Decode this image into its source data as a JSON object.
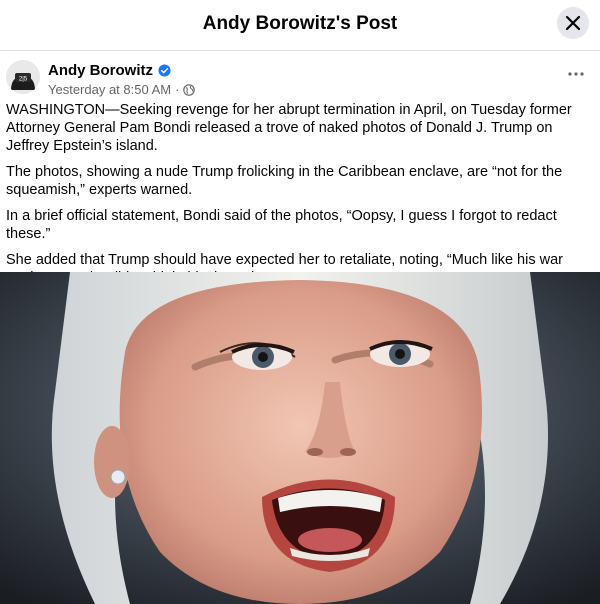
{
  "header": {
    "title": "Andy Borowitz's Post"
  },
  "post": {
    "author": "Andy Borowitz",
    "verified_badge": "verified-icon",
    "timestamp": "Yesterday at 8:50 AM",
    "separator": "·",
    "audience_icon": "globe-icon",
    "paragraphs": [
      "WASHINGTON—Seeking revenge for her abrupt termination in April, on Tuesday former Attorney General Pam Bondi released a trove of naked photos of Donald J. Trump on Jeffrey Epstein’s island.",
      "The photos, showing a nude Trump frolicking in the Caribbean enclave, are “not for the squeamish,” experts warned.",
      "In a brief official statement, Bondi said of the photos, “Oopsy, I guess I forgot to redact these.”",
      "She added that Trump should have expected her to retaliate, noting, “Much like his war against Iran, he didn’t think this through.”"
    ]
  },
  "colors": {
    "accent": "#1877f2",
    "secondary_text": "#65676b",
    "button_bg": "#e4e6eb"
  }
}
